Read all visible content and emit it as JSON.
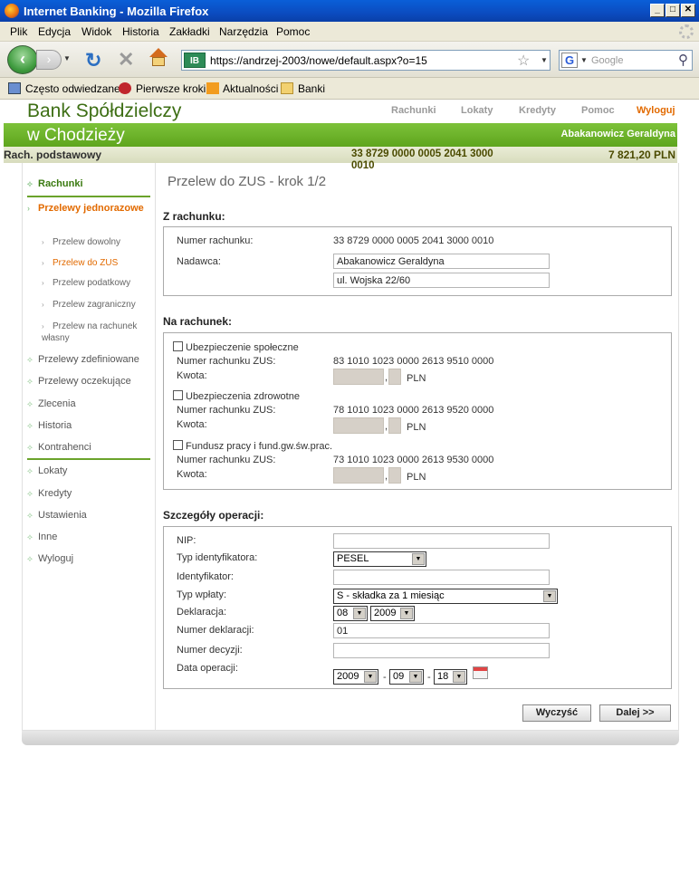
{
  "window": {
    "title": "Internet Banking - Mozilla Firefox"
  },
  "menu": [
    "Plik",
    "Edycja",
    "Widok",
    "Historia",
    "Zakładki",
    "Narzędzia",
    "Pomoc"
  ],
  "browser": {
    "url": "https://andrzej-2003/nowe/default.aspx?o=15",
    "site_badge": "IB",
    "search_placeholder": "Google"
  },
  "bookmarks": [
    "Często odwiedzane",
    "Pierwsze kroki",
    "Aktualności",
    "Banki"
  ],
  "bank": {
    "name_line1": "Bank Spółdzielczy",
    "name_line2": "w Chodzieży",
    "user": "Abakanowicz Geraldyna"
  },
  "topnav": [
    "Rachunki",
    "Lokaty",
    "Kredyty",
    "Pomoc",
    "Wyloguj"
  ],
  "account_bar": {
    "name": "Rach. podstawowy",
    "number": "33 8729 0000 0005 2041 3000 0010",
    "balance": "7 821,20 PLN"
  },
  "sidebar": {
    "rachunki": "Rachunki",
    "przelewy_jednorazowe": "Przelewy jednorazowe",
    "sub": [
      "Przelew dowolny",
      "Przelew do ZUS",
      "Przelew podatkowy",
      "Przelew zagraniczny",
      "Przelew na rachunek własny"
    ],
    "items": [
      "Przelewy zdefiniowane",
      "Przelewy oczekujące",
      "Zlecenia",
      "Historia",
      "Kontrahenci"
    ],
    "items2": [
      "Lokaty",
      "Kredyty",
      "Ustawienia",
      "Inne",
      "Wyloguj"
    ]
  },
  "main": {
    "title": "Przelew do ZUS - krok 1/2",
    "from": {
      "section": "Z rachunku:",
      "account_label": "Numer rachunku:",
      "account_value": "33 8729 0000 0005 2041 3000 0010",
      "sender_label": "Nadawca:",
      "sender_name": "Abakanowicz Geraldyna",
      "sender_address": "ul. Wojska 22/60"
    },
    "to": {
      "section": "Na rachunek:",
      "zus_label": "Numer rachunku ZUS:",
      "amount_label": "Kwota:",
      "currency": "PLN",
      "comma": ",",
      "entries": [
        {
          "name": "Ubezpieczenie społeczne",
          "account": "83 1010 1023 0000 2613 9510 0000"
        },
        {
          "name": "Ubezpieczenia zdrowotne",
          "account": "78 1010 1023 0000 2613 9520 0000"
        },
        {
          "name": "Fundusz pracy i fund.gw.św.prac.",
          "account": "73 1010 1023 0000 2613 9530 0000"
        }
      ]
    },
    "details": {
      "section": "Szczegóły operacji:",
      "nip_label": "NIP:",
      "id_type_label": "Typ identyfikatora:",
      "id_type_value": "PESEL",
      "id_label": "Identyfikator:",
      "payment_type_label": "Typ wpłaty:",
      "payment_type_value": "S - składka za 1 miesiąc",
      "declaration_label": "Deklaracja:",
      "declaration_month": "08",
      "declaration_year": "2009",
      "declaration_number_label": "Numer deklaracji:",
      "declaration_number_value": "01",
      "decision_number_label": "Numer decyzji:",
      "date_label": "Data operacji:",
      "date_year": "2009",
      "date_month": "09",
      "date_day": "18",
      "date_sep": "-"
    },
    "buttons": {
      "clear": "Wyczyść",
      "next": "Dalej >>"
    }
  }
}
